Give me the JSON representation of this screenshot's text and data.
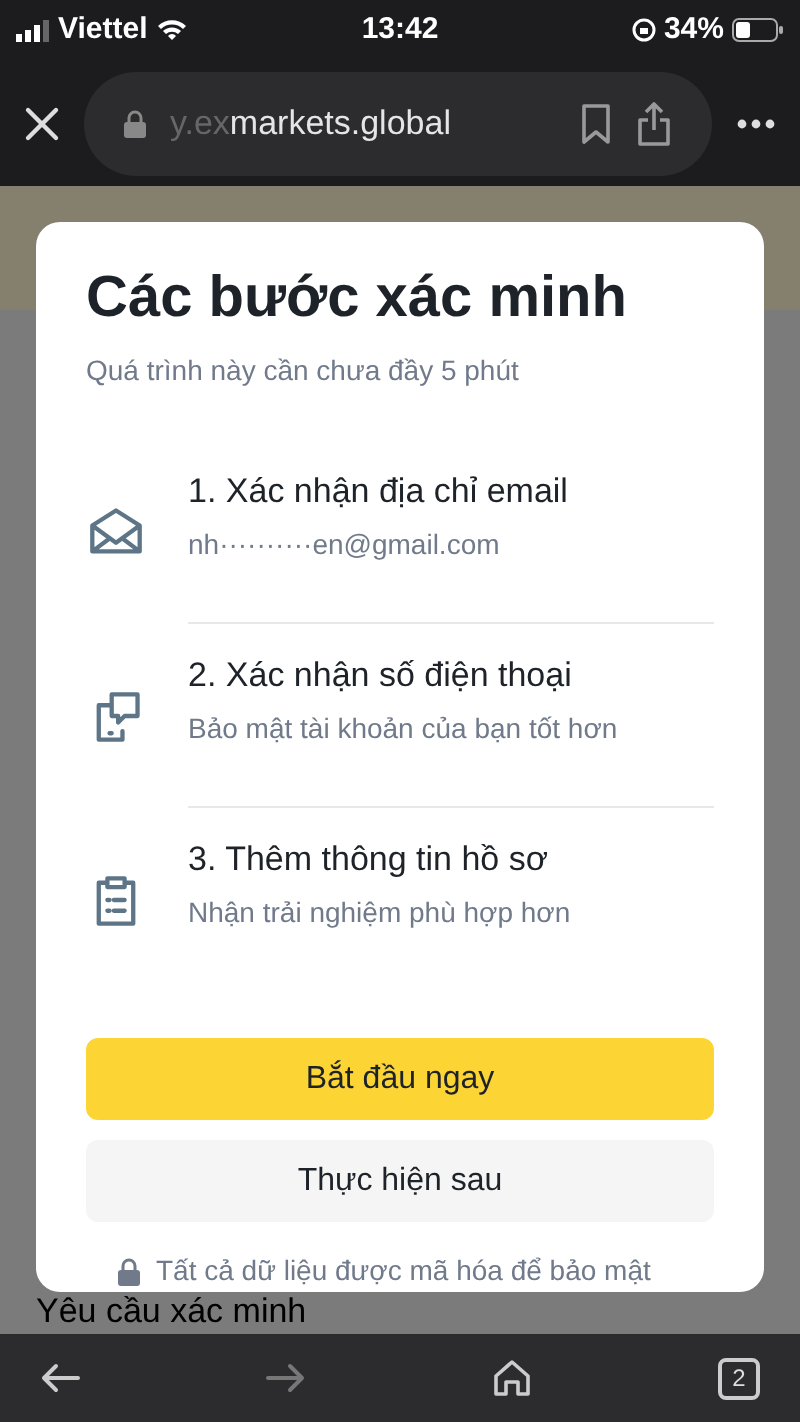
{
  "status_bar": {
    "carrier": "Viettel",
    "time": "13:42",
    "battery": "34%"
  },
  "browser": {
    "url_faded": "y.ex",
    "url_main": "markets.global"
  },
  "modal": {
    "title": "Các bước xác minh",
    "subtitle": "Quá trình này cần chưa đầy 5 phút",
    "steps": [
      {
        "kind": "email",
        "title": "1. Xác nhận địa chỉ email",
        "subtitle": "nh··········en@gmail.com"
      },
      {
        "kind": "phone",
        "title": "2. Xác nhận số điện thoại",
        "subtitle": "Bảo mật tài khoản của bạn tốt hơn"
      },
      {
        "kind": "profile",
        "title": "3. Thêm thông tin hồ sơ",
        "subtitle": "Nhận trải nghiệm phù hợp hơn"
      }
    ],
    "primary_button": "Bắt đầu ngay",
    "secondary_button": "Thực hiện sau",
    "footnote": "Tất cả dữ liệu được mã hóa để bảo mật"
  },
  "page_heading": "Yêu cầu xác minh",
  "toolbar": {
    "tab_count": "2"
  }
}
